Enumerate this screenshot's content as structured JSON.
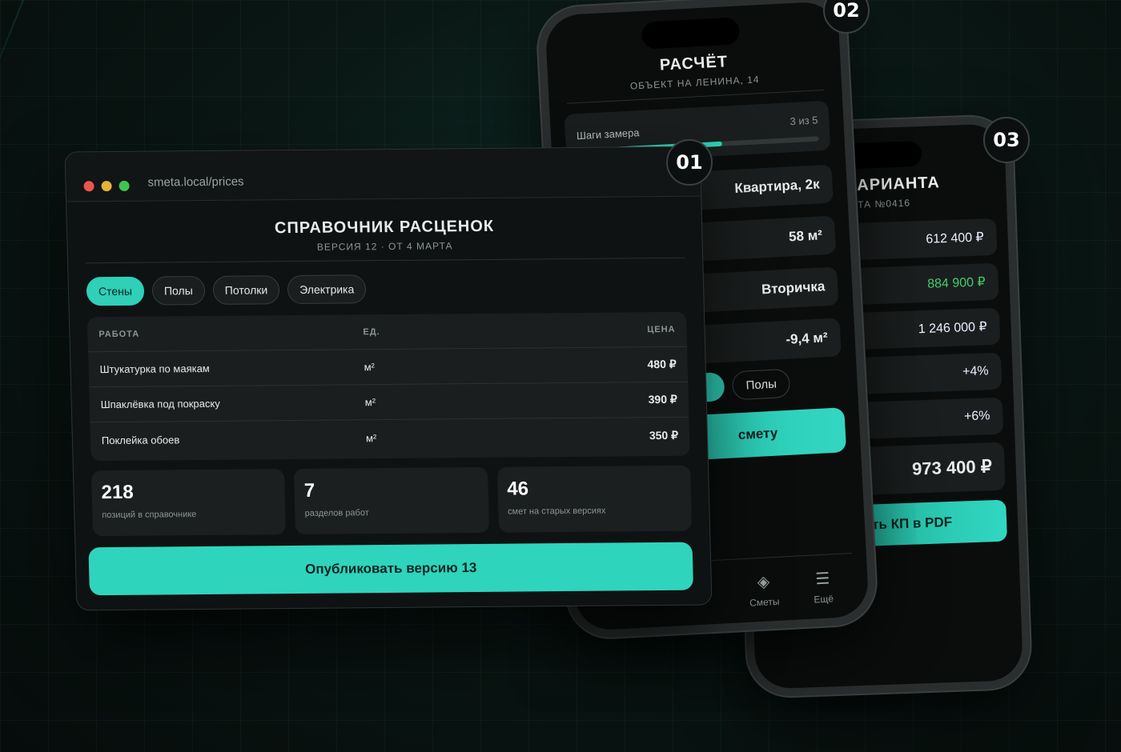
{
  "colors": {
    "accent": "#2fcfb8",
    "success_text": "#3ecf6e",
    "background": "#0a1714"
  },
  "badges": {
    "b01": "01",
    "b02": "02",
    "b03": "03"
  },
  "browser": {
    "url": "smeta.local/prices",
    "title": "СПРАВОЧНИК РАСЦЕНОК",
    "subtitle": "ВЕРСИЯ 12 · ОТ 4 МАРТА",
    "tabs": [
      {
        "label": "Стены",
        "active": true
      },
      {
        "label": "Полы",
        "active": false
      },
      {
        "label": "Потолки",
        "active": false
      },
      {
        "label": "Электрика",
        "active": false
      }
    ],
    "table": {
      "headers": {
        "work": "РАБОТА",
        "unit": "ЕД.",
        "price": "ЦЕНА"
      },
      "rows": [
        {
          "work": "Штукатурка по маякам",
          "unit": "м²",
          "price": "480 ₽"
        },
        {
          "work": "Шпаклёвка под покраску",
          "unit": "м²",
          "price": "390 ₽"
        },
        {
          "work": "Поклейка обоев",
          "unit": "м²",
          "price": "350 ₽"
        }
      ]
    },
    "stats": [
      {
        "value": "218",
        "label": "позиций в справочнике"
      },
      {
        "value": "7",
        "label": "разделов работ"
      },
      {
        "value": "46",
        "label": "смет на старых версиях"
      }
    ],
    "publish_label": "Опубликовать версию 13"
  },
  "phone2": {
    "title": "РАСЧЁТ",
    "subtitle": "ОБЪЕКТ НА ЛЕНИНА, 14",
    "progress": {
      "label": "Шаги замера",
      "count": "3 из 5",
      "fraction": 0.6
    },
    "fields": [
      "Квартира, 2к",
      "58 м²",
      "Вторичка",
      "-9,4 м²"
    ],
    "chip": "Полы",
    "cta": "смету",
    "tabbar": [
      {
        "icon": "diamond-icon",
        "label": "Сметы"
      },
      {
        "icon": "menu-icon",
        "label": "Ещё"
      }
    ]
  },
  "phone3": {
    "title": "АРИАНТА",
    "subtitle": "ТА №0416",
    "rows": [
      "612 400 ₽",
      "884 900 ₽",
      "1 246 000 ₽",
      "+4%",
      "+6%"
    ],
    "total": "973 400 ₽",
    "pdf_button": "ть КП в PDF"
  }
}
